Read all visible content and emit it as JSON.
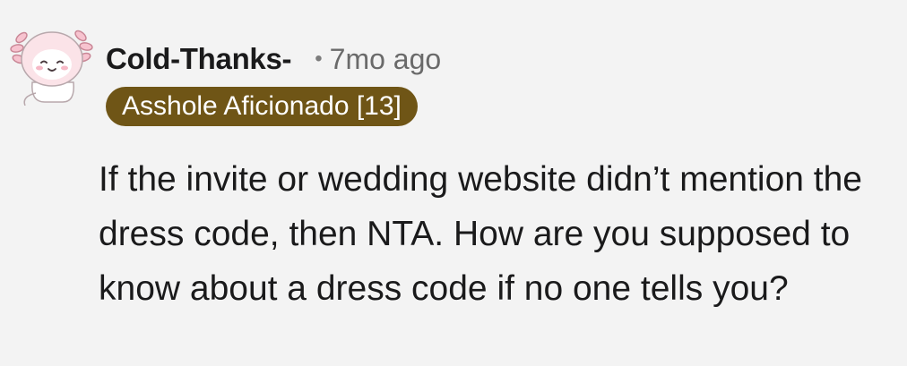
{
  "comment": {
    "avatar": {
      "icon": "axolotl-avatar-icon",
      "accent": "#f4b6c2"
    },
    "username": "Cold-Thanks-",
    "separator": "•",
    "timestamp": "7mo ago",
    "flair": {
      "label": "Asshole Aficionado [13]",
      "color": "#6f5516"
    },
    "body": "If the invite or wedding website didn’t mention the dress code, then NTA. How are you supposed to know about a dress code if no one tells you?"
  }
}
